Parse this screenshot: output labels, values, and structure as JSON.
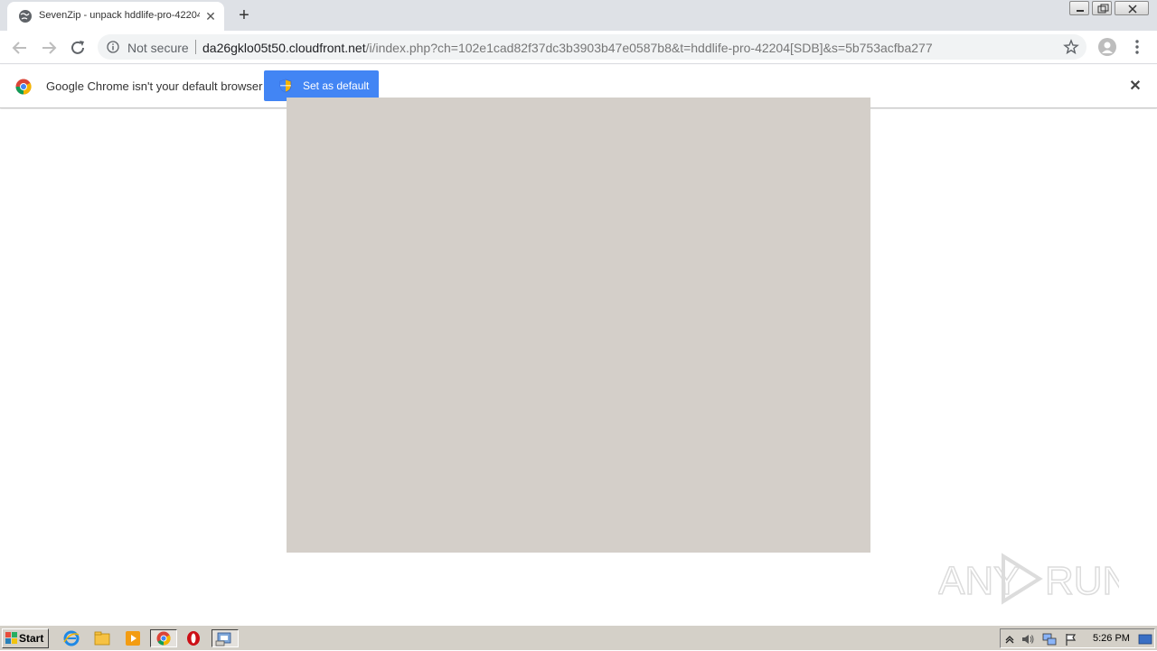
{
  "browser": {
    "tab": {
      "title": "SevenZip - unpack hddlife-pro-42204",
      "close_icon": "close-icon"
    },
    "new_tab_label": "+",
    "address": {
      "security_label": "Not secure",
      "host": "da26gklo05t50.cloudfront.net",
      "path": "/i/index.php?ch=102e1cad82f37dc3b3903b47e0587b8&t=hddlife-pro-42204[SDB]&s=5b753acfba277"
    },
    "infobar": {
      "message": "Google Chrome isn't your default browser",
      "button_label": "Set as default",
      "close_label": "✕"
    }
  },
  "page": {
    "panel_color": "#d4cfc9"
  },
  "watermark": {
    "text_left": "ANY",
    "text_right": "RUN"
  },
  "taskbar": {
    "start_label": "Start",
    "clock": "5:26 PM",
    "pinned_icons": [
      "ie-icon",
      "explorer-icon",
      "media-player-icon",
      "chrome-icon",
      "opera-icon",
      "installer-icon"
    ]
  },
  "colors": {
    "accent": "#4285f4",
    "titlebar": "#dee1e6",
    "taskbar": "#d4d0c8"
  }
}
